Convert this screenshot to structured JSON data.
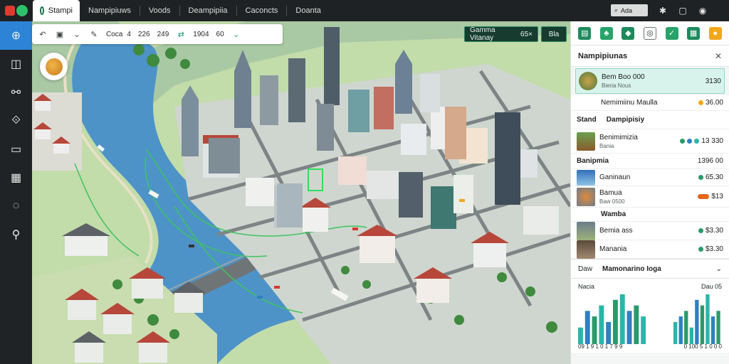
{
  "topbar": {
    "active_tab": "Stampi",
    "tabs": [
      "Nampipiuws",
      "Voods",
      "Deampipiia",
      "Caconcts",
      "Doanta"
    ],
    "search_label": "Ada",
    "colors": {
      "logo_red": "#e33a2f",
      "logo_green": "#2ec16c"
    }
  },
  "sidebar": {
    "items": [
      {
        "icon": "build-icon",
        "active": true
      },
      {
        "icon": "layers-icon",
        "active": false
      },
      {
        "icon": "route-icon",
        "active": false
      },
      {
        "icon": "zone-icon",
        "active": false
      },
      {
        "icon": "budget-icon",
        "active": false
      },
      {
        "icon": "stats-icon",
        "active": false
      },
      {
        "icon": "chat-icon",
        "active": false
      },
      {
        "icon": "search-icon",
        "active": false
      }
    ]
  },
  "map_toolbar": {
    "field1_label": "Coca",
    "field1_value": "4",
    "field2_value": "226",
    "field3_value": "249",
    "field4_value": "1904",
    "field5_value": "60"
  },
  "status": {
    "pill_label": "Gamma Vitanay",
    "pill_value": "65",
    "action_label": "Bla"
  },
  "rightpanel": {
    "header_title": "Nampipiunas",
    "featured": {
      "title": "Bem Boo 000",
      "sub": "Bieria Nous",
      "value": "3130",
      "accent": "#1f9e74"
    },
    "row2": {
      "title": "Nemimiinu Maulla",
      "value": "36.00",
      "dot": "#f2a71b"
    },
    "section1": {
      "label": "Stand",
      "title": "Dampipisiy"
    },
    "item1": {
      "title": "Benimimizia",
      "sub": "Bania",
      "value": "13 330"
    },
    "section2": {
      "label": "Banipmia",
      "value": "1396 00"
    },
    "item2": {
      "title": "Ganinaun",
      "value": "65.30"
    },
    "item3": {
      "title": "Bamua",
      "sub": "Baw 0500",
      "value": "$13",
      "dot": "#e8641b"
    },
    "section3": {
      "title": "Wamba"
    },
    "item4": {
      "title": "Bemia ass",
      "value": "$3.30"
    },
    "item5": {
      "title": "Manania",
      "value": "$3.30"
    },
    "dropdown": {
      "prefix": "Daw",
      "label": "Mamonarino Ioga"
    },
    "charts_header_left": "Nacia",
    "charts_header_right": "Dau 05",
    "charts_footer_left": "09 1 9 1 0 1 7 9 9",
    "charts_footer_right": "0 100 5 1 0 0 0",
    "colors": {
      "green": "#2a9a6a",
      "blue": "#2f7fc1",
      "teal": "#29b6a8"
    }
  },
  "chart_data": [
    {
      "type": "bar",
      "title": "",
      "xlabel": "",
      "ylabel": "",
      "series": [
        {
          "values": [
            3,
            6,
            5,
            7,
            4,
            8,
            9,
            6,
            7,
            5
          ]
        }
      ]
    },
    {
      "type": "bar",
      "title": "",
      "xlabel": "",
      "ylabel": "",
      "series": [
        {
          "values": [
            4,
            5,
            6,
            3,
            8,
            7,
            9,
            5,
            6
          ]
        }
      ]
    }
  ]
}
